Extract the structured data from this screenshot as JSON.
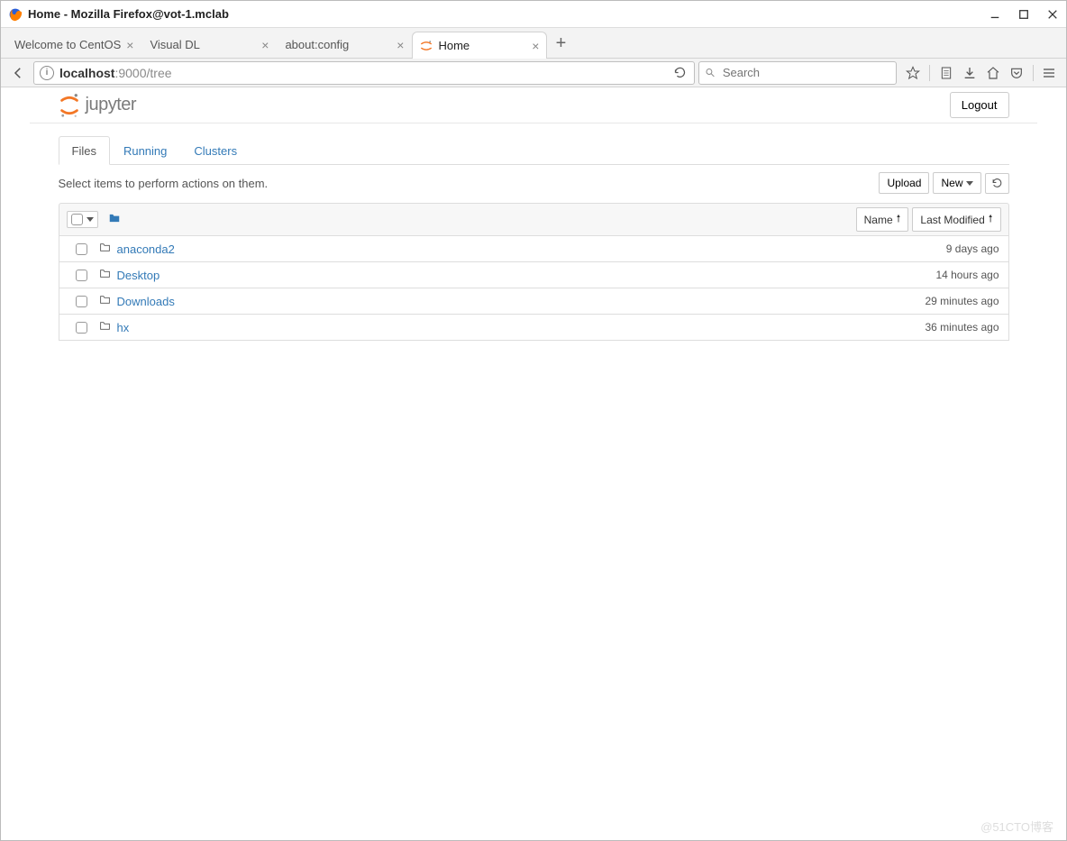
{
  "window": {
    "title": "Home - Mozilla Firefox@vot-1.mclab"
  },
  "tabs": [
    {
      "label": "Welcome to CentOS",
      "active": false
    },
    {
      "label": "Visual DL",
      "active": false
    },
    {
      "label": "about:config",
      "active": false
    },
    {
      "label": "Home",
      "active": true
    }
  ],
  "url": {
    "host": "localhost",
    "rest": ":9000/tree"
  },
  "search": {
    "placeholder": "Search"
  },
  "jupyter": {
    "logout": "Logout",
    "tabs": {
      "files": "Files",
      "running": "Running",
      "clusters": "Clusters"
    },
    "hint": "Select items to perform actions on them.",
    "buttons": {
      "upload": "Upload",
      "new": "New"
    },
    "sort": {
      "name": "Name",
      "modified": "Last Modified"
    },
    "items": [
      {
        "name": "anaconda2",
        "modified": "9 days ago"
      },
      {
        "name": "Desktop",
        "modified": "14 hours ago"
      },
      {
        "name": "Downloads",
        "modified": "29 minutes ago"
      },
      {
        "name": "hx",
        "modified": "36 minutes ago"
      }
    ]
  },
  "watermark": "@51CTO博客"
}
